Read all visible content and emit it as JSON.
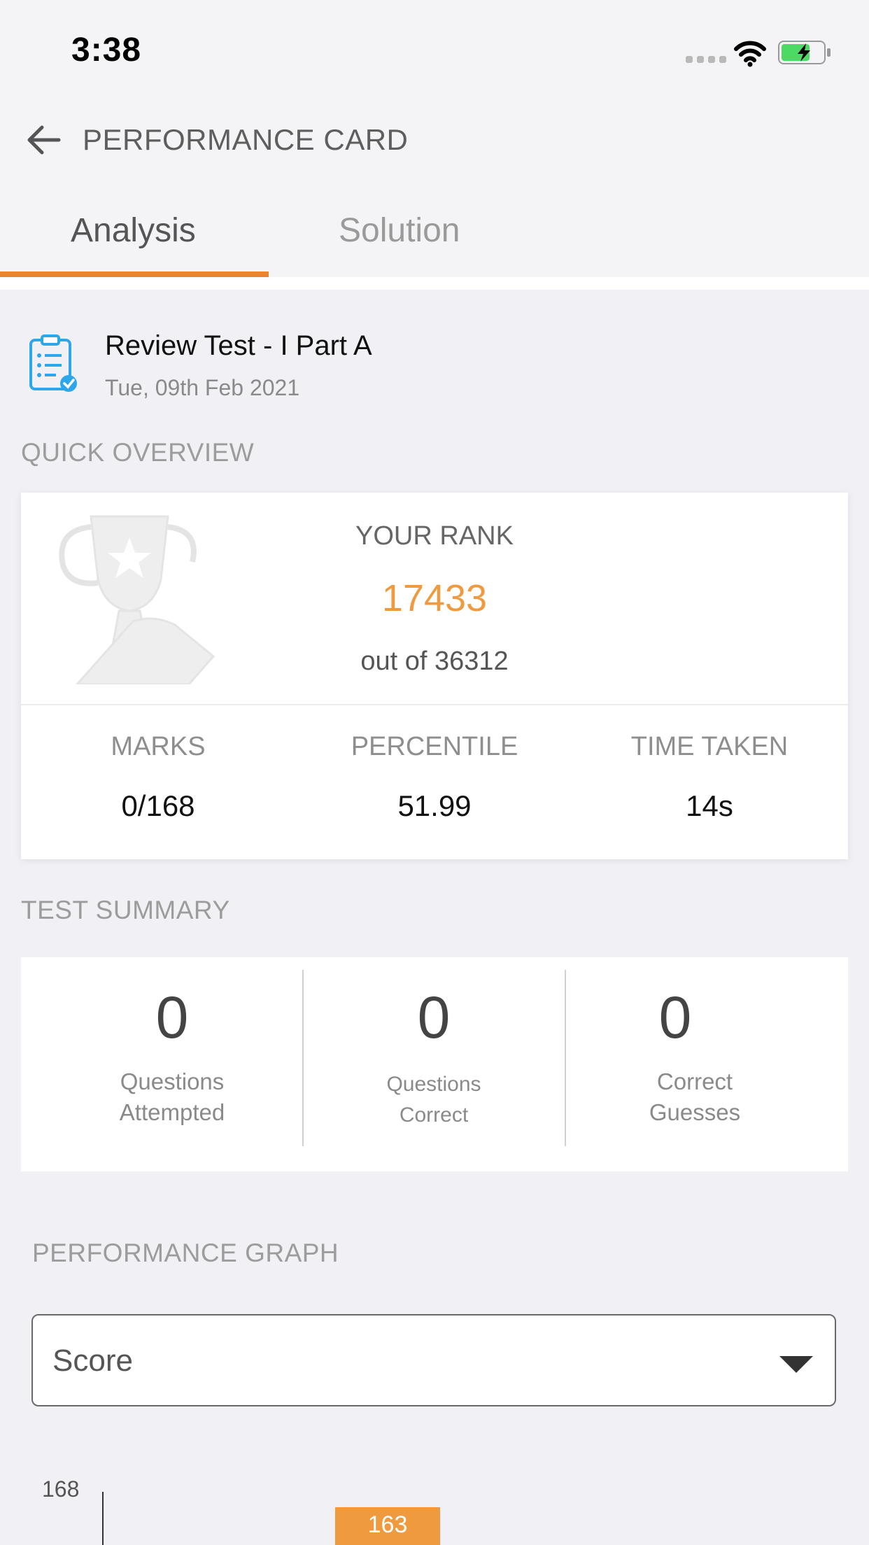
{
  "status_bar": {
    "time": "3:38"
  },
  "appbar": {
    "title": "PERFORMANCE CARD"
  },
  "tabs": [
    {
      "label": "Analysis",
      "active": true
    },
    {
      "label": "Solution",
      "active": false
    }
  ],
  "test": {
    "title": "Review Test - I Part A",
    "date": "Tue, 09th Feb 2021"
  },
  "overview": {
    "section_label": "QUICK OVERVIEW",
    "rank_label": "YOUR RANK",
    "rank_value": "17433",
    "rank_out_of": "out of 36312",
    "stats": [
      {
        "label": "MARKS",
        "value": "0/168"
      },
      {
        "label": "PERCENTILE",
        "value": "51.99"
      },
      {
        "label": "TIME TAKEN",
        "value": "14s"
      }
    ]
  },
  "summary": {
    "section_label": "TEST SUMMARY",
    "items": [
      {
        "value": "0",
        "label_line1": "Questions",
        "label_line2": "Attempted"
      },
      {
        "value": "0",
        "label_line1": "Questions",
        "label_line2": "Correct"
      },
      {
        "value": "0",
        "label_line1": "Correct",
        "label_line2": "Guesses"
      }
    ]
  },
  "graph": {
    "section_label": "PERFORMANCE GRAPH",
    "selected": "Score"
  },
  "chart_data": {
    "type": "bar",
    "y_tick_top": "168",
    "values": [
      163
    ]
  },
  "colors": {
    "accent": "#e8862f",
    "rank": "#ef9a3e"
  }
}
